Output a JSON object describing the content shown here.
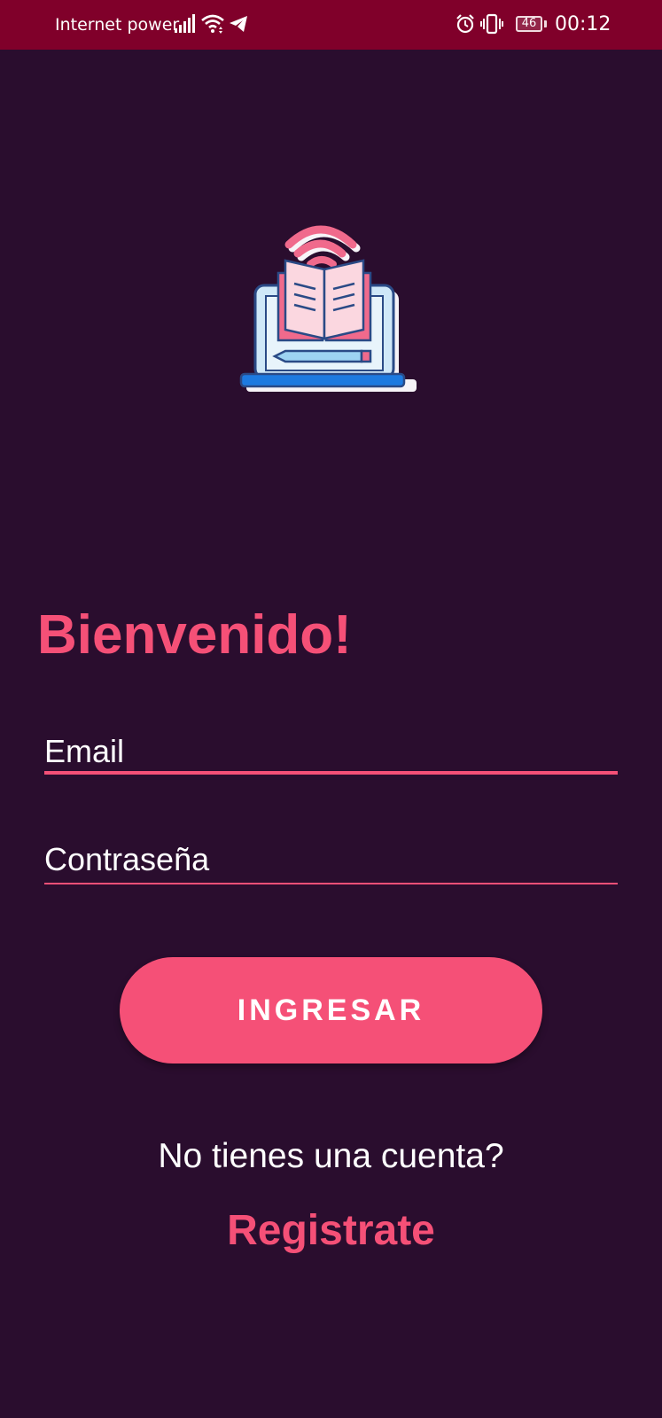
{
  "status_bar": {
    "carrier": "Internet power",
    "battery_level": "46",
    "time": "00:12",
    "icons": [
      "signal-icon",
      "wifi-icon",
      "telegram-icon",
      "alarm-icon",
      "vibrate-icon",
      "battery-icon"
    ]
  },
  "logo": {
    "icon": "open-book-laptop-icon"
  },
  "welcome_title": "Bienvenido!",
  "form": {
    "email_placeholder": "Email",
    "email_value": "",
    "password_placeholder": "Contraseña",
    "password_value": "",
    "submit_label": "INGRESAR"
  },
  "footer": {
    "prompt": "No tienes una cuenta?",
    "register_label": "Registrate"
  },
  "colors": {
    "background": "#2a0d2e",
    "status_bar": "#80002a",
    "accent": "#f55077",
    "text": "#ffffff"
  }
}
